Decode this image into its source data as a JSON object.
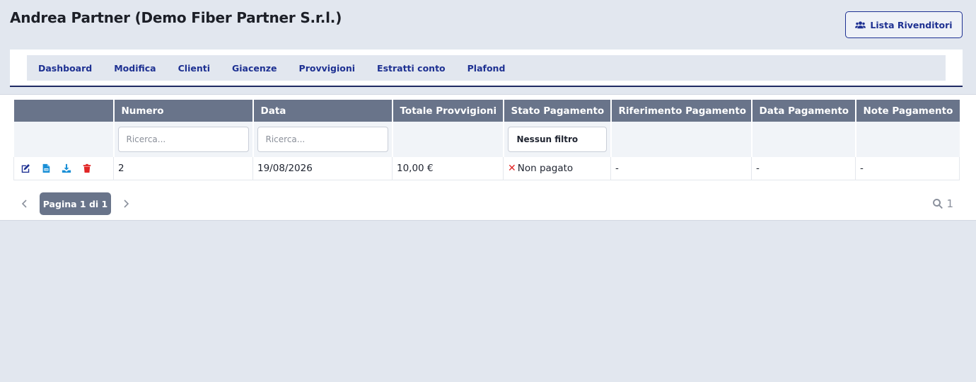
{
  "header": {
    "title": "Andrea Partner (Demo Fiber Partner S.r.l.)",
    "resellers_button": "Lista Rivenditori"
  },
  "nav": {
    "items": [
      "Dashboard",
      "Modifica",
      "Clienti",
      "Giacenze",
      "Provvigioni",
      "Estratti conto",
      "Plafond"
    ]
  },
  "table": {
    "columns": [
      "Numero",
      "Data",
      "Totale Provvigioni",
      "Stato Pagamento",
      "Riferimento Pagamento",
      "Data Pagamento",
      "Note Pagamento"
    ],
    "filters": {
      "numero_placeholder": "Ricerca...",
      "data_placeholder": "Ricerca...",
      "stato_value": "Nessun filtro"
    },
    "rows": [
      {
        "numero": "2",
        "data": "19/08/2026",
        "totale": "10,00 €",
        "stato": "Non pagato",
        "riferimento": "-",
        "data_pagamento": "-",
        "note": "-"
      }
    ]
  },
  "pager": {
    "label": "Pagina 1 di 1",
    "count": "1"
  },
  "colors": {
    "accent": "#1e3192",
    "header_bg": "#69748a",
    "danger": "#e12626",
    "action_blue": "#1a8fd6"
  }
}
